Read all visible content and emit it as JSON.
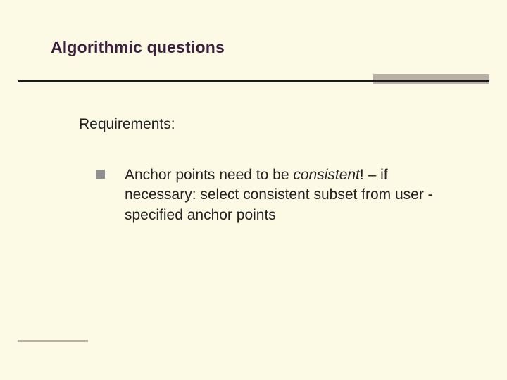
{
  "slide": {
    "title": "Algorithmic questions",
    "requirements_heading": "Requirements:",
    "bullets": [
      {
        "pre": "Anchor points need to be ",
        "em": "consistent",
        "post": "! – if necessary: select consistent subset from user -specified anchor points"
      }
    ]
  }
}
